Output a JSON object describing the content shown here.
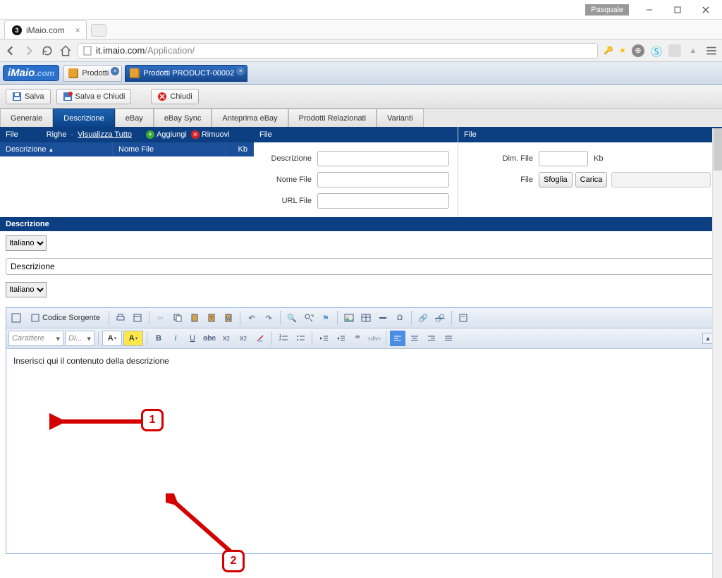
{
  "window": {
    "user": "Pasquale"
  },
  "browser": {
    "tab_title": "iMaio.com",
    "url_prefix": "it.imaio.com",
    "url_path": "/Application/"
  },
  "app": {
    "logo_main": "iMaio",
    "logo_suffix": ".com",
    "tabs": [
      {
        "label": "Prodotti"
      },
      {
        "label": "Prodotti  PRODUCT-00002"
      }
    ]
  },
  "toolbar": {
    "save": "Salva",
    "save_close": "Salva e Chiudi",
    "close": "Chiudi"
  },
  "subtabs": [
    "Generale",
    "Descrizione",
    "eBay",
    "eBay Sync",
    "Anteprima eBay",
    "Prodotti Relazionati",
    "Varianti"
  ],
  "grid": {
    "file": "File",
    "righe": "Righe",
    "vis_tutto": "Visualizza Tutto",
    "aggiungi": "Aggiungi",
    "rimuovi": "Rimuovi",
    "col_desc": "Descrizione",
    "col_nomefile": "Nome File",
    "col_kb": "Kb"
  },
  "form": {
    "descrizione": "Descrizione",
    "nomefile": "Nome File",
    "urlfile": "URL File",
    "dimfile": "Dim. File",
    "kb": "Kb",
    "file": "File",
    "sfoglia": "Sfoglia",
    "carica": "Carica"
  },
  "desc": {
    "header": "Descrizione",
    "lang": "Italiano",
    "title_value": "Descrizione",
    "lang2": "Italiano"
  },
  "editor": {
    "source_btn": "Codice Sorgente",
    "font_sel": "Carattere",
    "size_sel": "Di...",
    "placeholder": "Inserisci qui il contenuto della descrizione"
  },
  "callouts": {
    "c1": "1",
    "c2": "2"
  }
}
